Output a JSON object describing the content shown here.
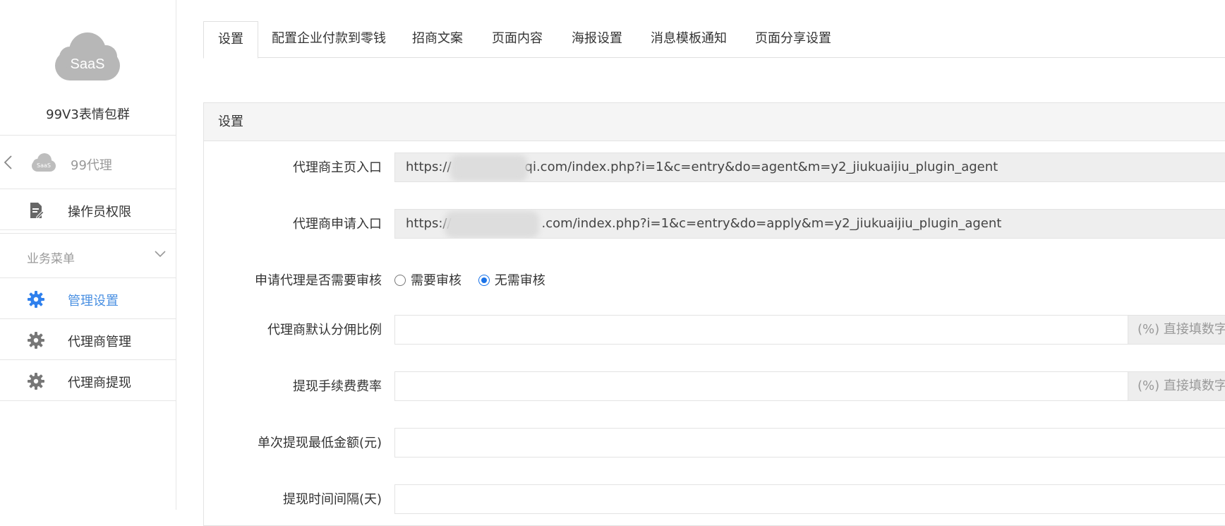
{
  "sidebar": {
    "logo_text": "SaaS",
    "brand_name": "99V3表情包群",
    "back_item": {
      "logo_text": "SaaS",
      "label": "99代理"
    },
    "operator_item": {
      "label": "操作员权限"
    },
    "section": {
      "label": "业务菜单"
    },
    "items": [
      {
        "label": "管理设置",
        "active": true
      },
      {
        "label": "代理商管理",
        "active": false
      },
      {
        "label": "代理商提现",
        "active": false
      }
    ]
  },
  "tabs": [
    {
      "label": "设置",
      "active": true
    },
    {
      "label": "配置企业付款到零钱"
    },
    {
      "label": "招商文案"
    },
    {
      "label": "页面内容"
    },
    {
      "label": "海报设置"
    },
    {
      "label": "消息模板通知"
    },
    {
      "label": "页面分享设置"
    }
  ],
  "panel": {
    "title": "设置",
    "fields": {
      "home_entry": {
        "label": "代理商主页入口",
        "prefix": "https://",
        "suffix": "qi.com/index.php?i=1&c=entry&do=agent&m=y2_jiukuaijiu_plugin_agent"
      },
      "apply_entry": {
        "label": "代理商申请入口",
        "prefix": "https://",
        "suffix": ".com/index.php?i=1&c=entry&do=apply&m=y2_jiukuaijiu_plugin_agent"
      },
      "need_review": {
        "label": "申请代理是否需要审核",
        "options": [
          "需要审核",
          "无需审核"
        ],
        "selected": "无需审核"
      },
      "commission_rate": {
        "label": "代理商默认分佣比例",
        "value": "",
        "addon": "(%) 直接填数字，"
      },
      "fee_rate": {
        "label": "提现手续费费率",
        "value": "",
        "addon": "(%) 直接填数字，"
      },
      "min_amount": {
        "label": "单次提现最低金额(元)",
        "value": ""
      },
      "interval": {
        "label": "提现时间间隔(天)",
        "value": ""
      }
    }
  },
  "colors": {
    "accent": "#4a90e2",
    "radio_blue": "#1a73e8",
    "logo_gray": "#b7b7b7",
    "readonly_bg": "#eeeeee"
  }
}
